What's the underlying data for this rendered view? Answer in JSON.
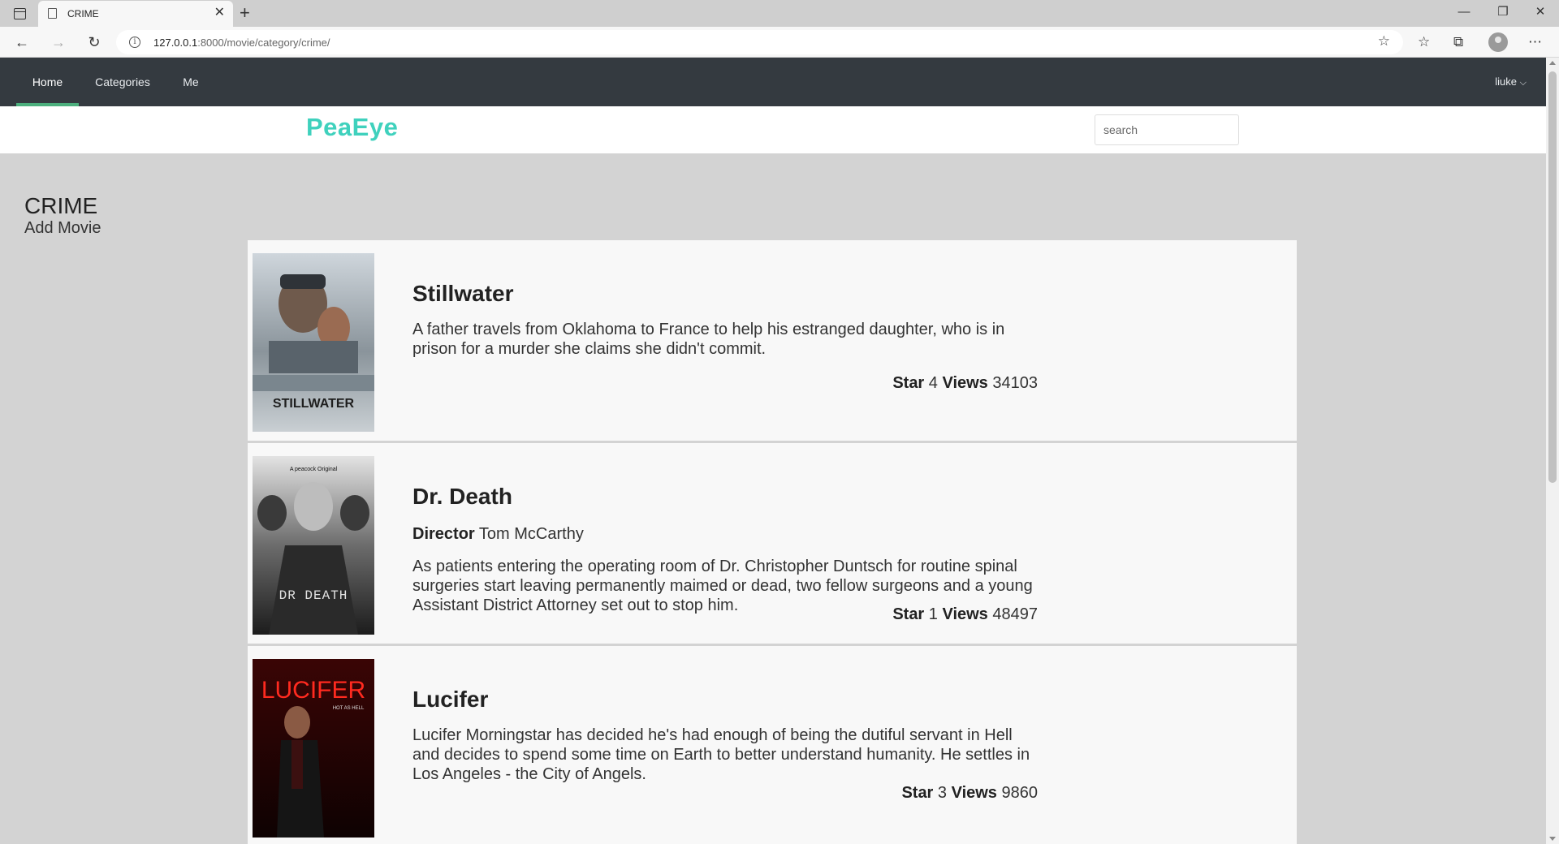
{
  "browser": {
    "tab_title": "CRIME",
    "url_host": "127.0.0.1",
    "url_path": ":8000/movie/category/crime/"
  },
  "nav": {
    "items": [
      "Home",
      "Categories",
      "Me"
    ],
    "user": "liuke"
  },
  "brand": "PeaEye",
  "search": {
    "placeholder": "search"
  },
  "category": {
    "title": "CRIME",
    "add_label": "Add Movie"
  },
  "movies": [
    {
      "title": "Stillwater",
      "description": "A father travels from Oklahoma to France to help his estranged daughter, who is in prison for a murder she claims she didn't commit.",
      "star_label": "Star",
      "star": "4",
      "views_label": "Views",
      "views": "34103",
      "poster_text": "STILLWATER"
    },
    {
      "title": "Dr. Death",
      "director_label": "Director",
      "director": "Tom McCarthy",
      "description": "As patients entering the operating room of Dr. Christopher Duntsch for routine spinal surgeries start leaving permanently maimed or dead, two fellow surgeons and a young Assistant District Attorney set out to stop him.",
      "star_label": "Star",
      "star": "1",
      "views_label": "Views",
      "views": "48497",
      "poster_text": "DR DEATH",
      "poster_subtext": "A peacock Original"
    },
    {
      "title": "Lucifer",
      "description": "Lucifer Morningstar has decided he's had enough of being the dutiful servant in Hell and decides to spend some time on Earth to better understand humanity. He settles in Los Angeles - the City of Angels.",
      "star_label": "Star",
      "star": "3",
      "views_label": "Views",
      "views": "9860",
      "poster_text": "LUCIFER",
      "poster_subtext": "HOT AS HELL"
    }
  ],
  "colors": {
    "navbar": "#343a40",
    "brand": "#3fd1bd",
    "active_indicator": "#4caf7d",
    "page_bg": "#d3d3d3"
  }
}
